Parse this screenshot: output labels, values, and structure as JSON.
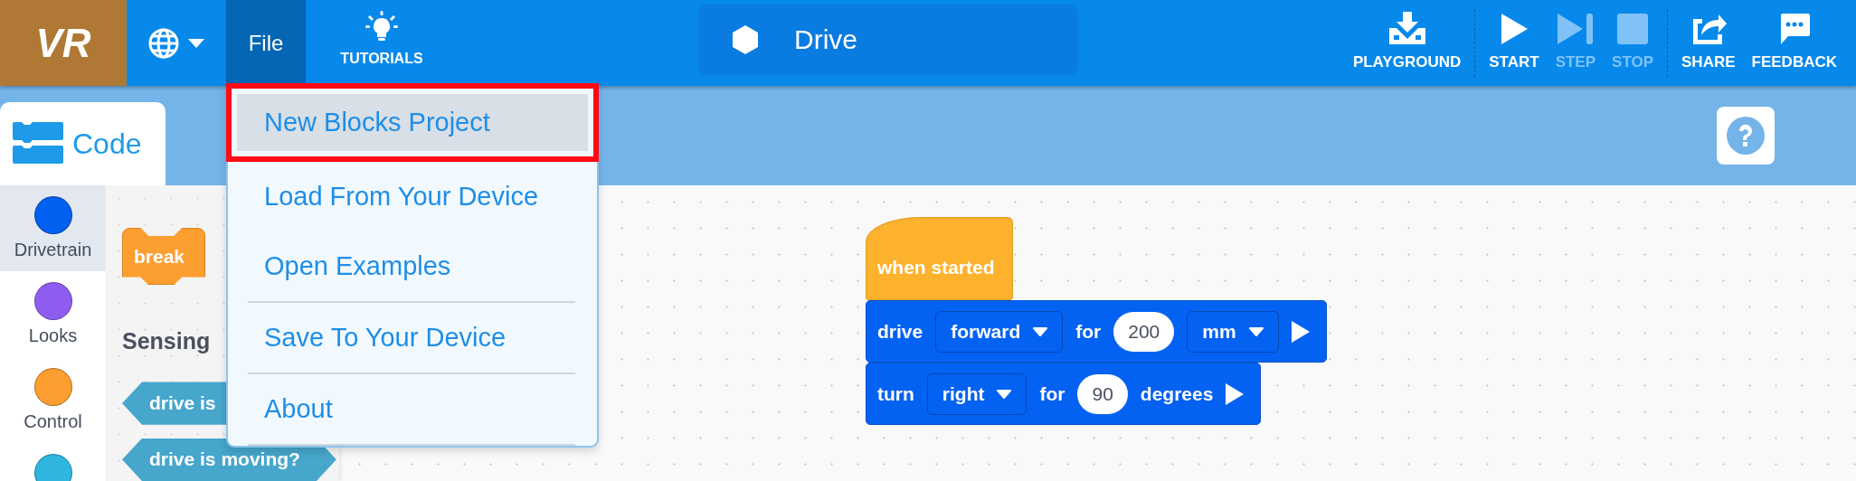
{
  "top_bar": {
    "logo": "VR",
    "file_button": {
      "label": "File",
      "open": true
    },
    "tutorials": "TUTORIALS",
    "project_name": "Drive",
    "actions": [
      {
        "kind": "playground",
        "label": "PLAYGROUND",
        "disabled": false
      },
      {
        "kind": "start",
        "label": "START",
        "disabled": false
      },
      {
        "kind": "step",
        "label": "STEP",
        "disabled": true
      },
      {
        "kind": "stop",
        "label": "STOP",
        "disabled": true
      },
      {
        "kind": "share",
        "label": "SHARE",
        "disabled": false
      },
      {
        "kind": "feedback",
        "label": "FEEDBACK",
        "disabled": false
      }
    ]
  },
  "code_tab": {
    "label": "Code",
    "selected": true
  },
  "categories": [
    {
      "label": "Drivetrain",
      "color": "#0060f0",
      "selected": true
    },
    {
      "label": "Looks",
      "color": "#8f5cf0",
      "selected": false
    },
    {
      "label": "Control",
      "color": "#fd9e30",
      "selected": false
    },
    {
      "color": "#2fb6df",
      "selected": false
    }
  ],
  "palette": {
    "blocks": [
      {
        "kind": "c_block",
        "text": "break"
      },
      {
        "kind": "heading",
        "text": "Sensing"
      },
      {
        "kind": "boolean",
        "text": "drive is"
      },
      {
        "kind": "boolean",
        "text": "drive is moving?"
      }
    ]
  },
  "workspace": {
    "script": [
      {
        "kind": "hat",
        "parts": [
          {
            "kind": "label",
            "text": "when started"
          }
        ]
      },
      {
        "kind": "command",
        "parts": [
          {
            "kind": "label",
            "text": "drive"
          },
          {
            "kind": "dropdown",
            "text": "forward"
          },
          {
            "kind": "label",
            "text": "for"
          },
          {
            "kind": "number",
            "text": "200"
          },
          {
            "kind": "dropdown",
            "text": "mm"
          },
          {
            "kind": "run"
          }
        ]
      },
      {
        "kind": "command",
        "parts": [
          {
            "kind": "label",
            "text": "turn"
          },
          {
            "kind": "dropdown",
            "text": "right"
          },
          {
            "kind": "label",
            "text": "for"
          },
          {
            "kind": "number",
            "text": "90"
          },
          {
            "kind": "label",
            "text": "degrees"
          },
          {
            "kind": "run"
          }
        ]
      }
    ]
  },
  "file_menu": {
    "items": [
      {
        "label": "New Blocks Project",
        "selected": true,
        "highlighted": true,
        "divider_below": false
      },
      {
        "label": "Load From Your Device",
        "selected": false,
        "highlighted": false,
        "divider_below": false
      },
      {
        "label": "Open Examples",
        "selected": false,
        "highlighted": false,
        "divider_below": true
      },
      {
        "label": "Save To Your Device",
        "selected": false,
        "highlighted": false,
        "divider_below": true
      },
      {
        "label": "About",
        "selected": false,
        "highlighted": false,
        "divider_below": true
      }
    ]
  }
}
